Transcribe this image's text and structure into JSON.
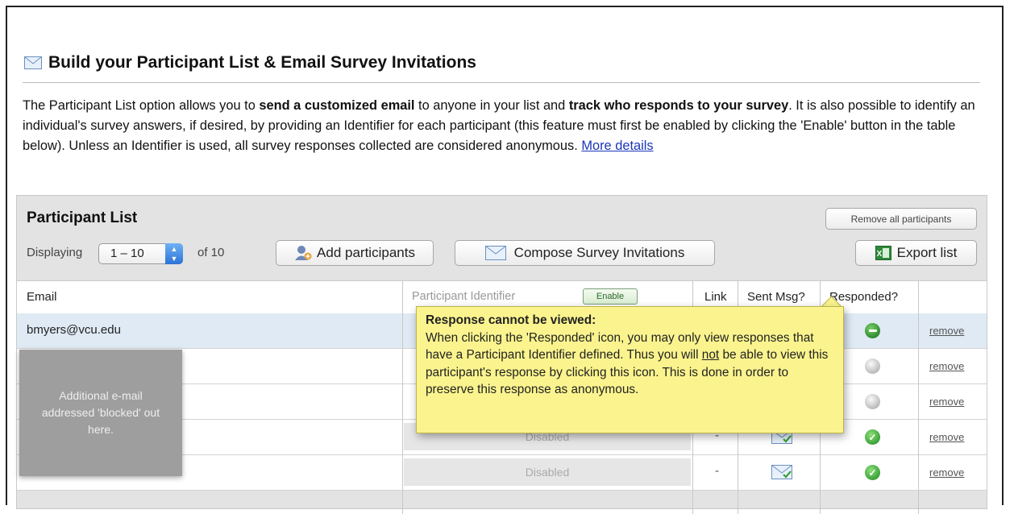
{
  "header": {
    "icon": "envelope-icon",
    "title": "Build your Participant List & Email Survey Invitations"
  },
  "intro": {
    "t1": "The Participant List option allows you to ",
    "b1": "send a customized email",
    "t2": " to anyone in your list and ",
    "b2": "track who responds to your survey",
    "t3": ". It is also possible to identify an individual's survey answers, if desired, by providing an Identifier for each participant (this feature must first be enabled by clicking the 'Enable' button in the table below). Unless an Identifier is used, all survey responses collected are considered anonymous. ",
    "link": "More details"
  },
  "panel": {
    "title": "Participant List",
    "remove_all": "Remove all participants",
    "displaying": "Displaying",
    "range": "1 – 10",
    "of": "of 10",
    "add": "Add participants",
    "compose": "Compose Survey Invitations",
    "export": "Export list"
  },
  "table": {
    "headers": {
      "email": "Email",
      "identifier": "Participant Identifier",
      "enable": "Enable",
      "link": "Link",
      "sent": "Sent Msg?",
      "responded": "Responded?"
    },
    "rows": [
      {
        "email": "bmyers@vcu.edu",
        "identifier": "",
        "link": "",
        "responded": "dark",
        "action": "remove"
      },
      {
        "email": "",
        "identifier": "",
        "link": "",
        "responded": "grey",
        "action": "remove"
      },
      {
        "email": "",
        "identifier": "",
        "link": "",
        "responded": "grey",
        "action": "remove"
      },
      {
        "email": "",
        "identifier": "Disabled",
        "link": "-",
        "responded": "green",
        "action": "remove"
      },
      {
        "email": "",
        "identifier": "Disabled",
        "link": "-",
        "responded": "green",
        "action": "remove"
      }
    ]
  },
  "blocker": {
    "text": "Additional e-mail addressed 'blocked' out here."
  },
  "tooltip": {
    "title": "Response cannot be viewed:",
    "l1": "When clicking the 'Responded' icon, you may only view responses that have a Participant Identifier defined. Thus you will ",
    "not": "not",
    "l2": " be able to view this participant's response by clicking this icon. This is done in order to preserve this response as anonymous."
  },
  "colors": {
    "accent_green": "#3aa23a",
    "tooltip_bg": "#fbf48e",
    "row_selected": "#dfeaf4",
    "link": "#1a35b8"
  }
}
